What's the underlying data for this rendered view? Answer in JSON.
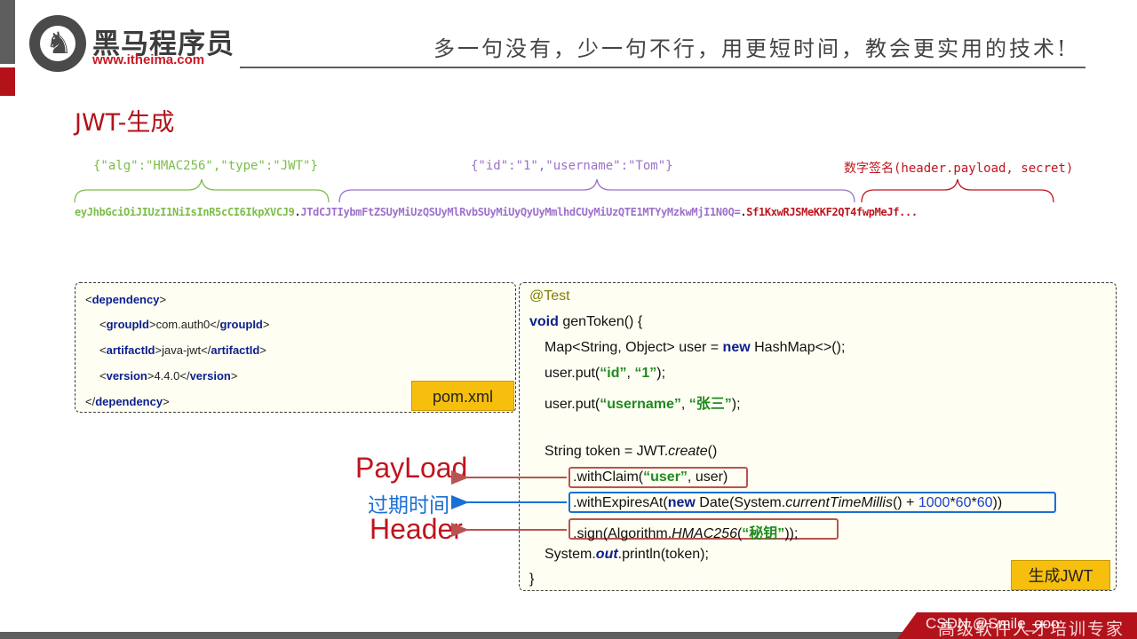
{
  "header": {
    "logo_cn": "黑马程序员",
    "logo_url": "www.itheima.com",
    "slogan": "多一句没有，少一句不行，用更短时间，教会更实用的技术!"
  },
  "title": "JWT-生成",
  "jwt": {
    "header_label": "{\"alg\":\"HMAC256\",\"type\":\"JWT\"}",
    "payload_label": "{\"id\":\"1\",\"username\":\"Tom\"}",
    "signature_label": "数字签名(header.payload, secret)",
    "token_header": "eyJhbGciOiJIUzI1NiIsInR5cCI6IkpXVCJ9",
    "token_payload": "JTdCJTIybmFtZSUyMiUzQSUyMlRvbSUyMiUyQyUyMmlhdCUyMiUzQTE1MTYyMzkwMjI1N0Q=",
    "token_signature": "Sf1KxwRJSMeKKF2QT4fwpMeJf...",
    "dot": ".",
    "colors": {
      "header": "#7cbd4a",
      "payload": "#9d70cc",
      "signature": "#c0141e"
    }
  },
  "pom": {
    "badge": "pom.xml",
    "lines": [
      {
        "open": "<",
        "tag": "dependency",
        "close": ">",
        "text": "",
        "end_open": "",
        "end_tag": "",
        "end_close": ""
      },
      {
        "open": "<",
        "tag": "groupId",
        "close": ">",
        "text": "com.auth0",
        "end_open": "</",
        "end_tag": "groupId",
        "end_close": ">"
      },
      {
        "open": "<",
        "tag": "artifactId",
        "close": ">",
        "text": "java-jwt",
        "end_open": "</",
        "end_tag": "artifactId",
        "end_close": ">"
      },
      {
        "open": "<",
        "tag": "version",
        "close": ">",
        "text": "4.4.0",
        "end_open": "</",
        "end_tag": "version",
        "end_close": ">"
      },
      {
        "open": "</",
        "tag": "dependency",
        "close": ">",
        "text": "",
        "end_open": "",
        "end_tag": "",
        "end_close": ""
      }
    ]
  },
  "code": {
    "badge": "生成JWT",
    "annotation": "@Test",
    "l2_kw": "void",
    "l2_rest": " genToken() {",
    "l3_a": "Map<String, Object> user = ",
    "l3_kw": "new",
    "l3_b": " HashMap<>();",
    "l4_a": "user.put(",
    "l4_s1": "“id”",
    "l4_b": ", ",
    "l4_s2": "“1”",
    "l4_c": ");",
    "l5_a": "user.put(",
    "l5_s1": "“username”",
    "l5_b": ", ",
    "l5_s2": "“张三”",
    "l5_c": ");",
    "l6_a": "String token = JWT.",
    "l6_it": "create",
    "l6_b": "()",
    "l7_a": ".withClaim(",
    "l7_s": "“user”",
    "l7_b": ", user)",
    "l8_a": ".withExpiresAt(",
    "l8_kw": "new",
    "l8_b": " Date(System.",
    "l8_it": "currentTimeMillis",
    "l8_c": "() + ",
    "l8_n1": "1000",
    "l8_d": "*",
    "l8_n2": "60",
    "l8_e": "*",
    "l8_n3": "60",
    "l8_f": "))",
    "l9_a": ".sign(Algorithm.",
    "l9_it": "HMAC256",
    "l9_b": "(",
    "l9_s": "“秘钥”",
    "l9_c": "));",
    "l10_a": "System.",
    "l10_fld": "out",
    "l10_b": ".println(token);",
    "l11": "}"
  },
  "labels": {
    "payload": "PayLoad",
    "expires": "过期时间",
    "header": "Header"
  },
  "footer": {
    "text": "高级软件人才培训专家",
    "watermark": "CSDN @Smile_ooo"
  }
}
